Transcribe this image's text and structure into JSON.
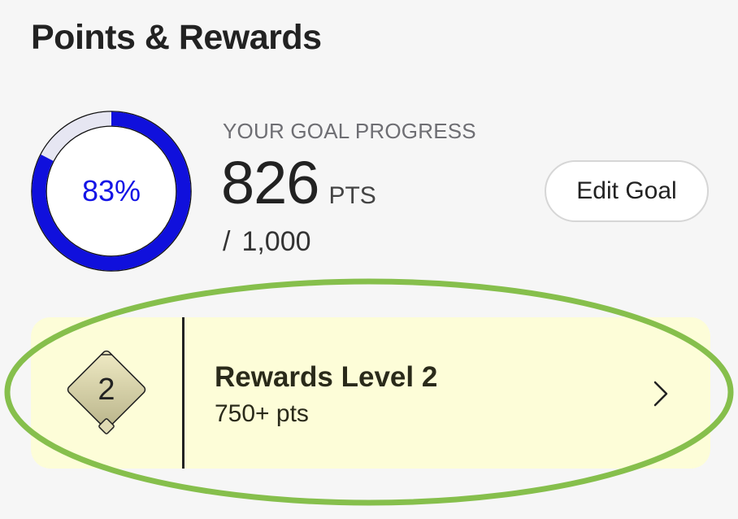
{
  "header": {
    "title": "Points & Rewards"
  },
  "goal": {
    "percent_label": "83%",
    "progress_fraction": 0.826,
    "caption": "YOUR GOAL PROGRESS",
    "points": "826",
    "unit": "PTS",
    "slash": "/",
    "total": "1,000",
    "edit_label": "Edit Goal"
  },
  "level": {
    "badge_number": "2",
    "name": "Rewards Level 2",
    "points_label": "750+ pts",
    "badge_icon": "diamond-badge-icon",
    "chevron_icon": "chevron-right-icon"
  },
  "colors": {
    "ring_progress": "#1010dc",
    "ring_track": "#e6e6f2",
    "ring_outline": "#111111",
    "card_background": "#fdfdd8",
    "highlight_ring": "#86bf4c",
    "percent_text": "#1414e6"
  }
}
